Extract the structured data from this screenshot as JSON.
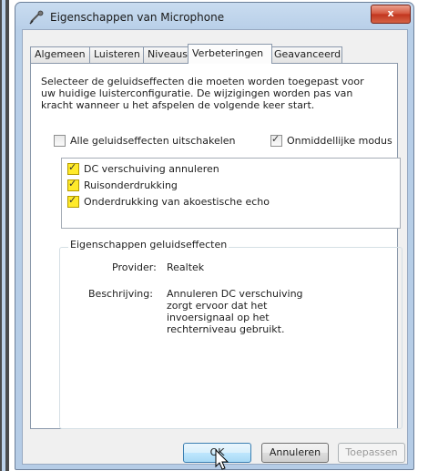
{
  "window": {
    "title": "Eigenschappen van Microphone",
    "close_label": "x"
  },
  "tabs": [
    {
      "label": "Algemeen",
      "active": false
    },
    {
      "label": "Luisteren",
      "active": false
    },
    {
      "label": "Niveaus",
      "active": false
    },
    {
      "label": "Verbeteringen",
      "active": true
    },
    {
      "label": "Geavanceerd",
      "active": false
    }
  ],
  "description": "Selecteer de geluidseffecten die moeten worden toegepast voor uw huidige luisterconfiguratie. De wijzigingen worden pas van kracht wanneer u het afspelen de volgende keer start.",
  "options": {
    "disable_all": {
      "label": "Alle geluidseffecten uitschakelen",
      "checked": false
    },
    "immediate_mode": {
      "label": "Onmiddellijke modus",
      "checked": true
    }
  },
  "effects": [
    {
      "label": "DC verschuiving annuleren",
      "checked": true
    },
    {
      "label": "Ruisonderdrukking",
      "checked": true
    },
    {
      "label": "Onderdrukking van akoestische echo",
      "checked": true
    }
  ],
  "properties": {
    "title": "Eigenschappen geluidseffecten",
    "provider_label": "Provider:",
    "provider_value": "Realtek",
    "description_label": "Beschrijving:",
    "description_value": "Annuleren DC verschuiving zorgt ervoor dat het invoersignaal op het rechterniveau gebruikt."
  },
  "buttons": {
    "ok": "OK",
    "cancel": "Annuleren",
    "apply": "Toepassen"
  },
  "colors": {
    "selection_highlight": "#ffea2a",
    "close_button": "#c1341d"
  }
}
